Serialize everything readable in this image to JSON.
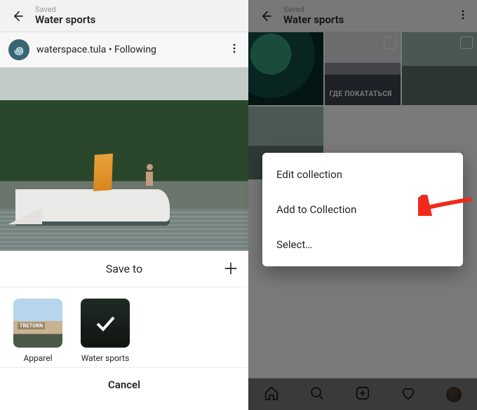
{
  "left": {
    "header": {
      "saved_label": "Saved",
      "collection_name": "Water sports"
    },
    "user": {
      "username": "waterspace.tula",
      "follow_status": "Following",
      "avatar_initial": "꩜"
    },
    "sheet": {
      "title": "Save to",
      "collections": [
        {
          "label": "Apparel",
          "brand_tag": "TRETORN"
        },
        {
          "label": "Water sports"
        }
      ],
      "cancel_label": "Cancel"
    }
  },
  "right": {
    "header": {
      "saved_label": "Saved",
      "collection_name": "Water sports"
    },
    "grid": {
      "tile2_caption": "ГДЕ ПОКАТАТЬСЯ",
      "tile2_sub": ""
    },
    "menu": {
      "items": [
        {
          "label": "Edit collection"
        },
        {
          "label": "Add to Collection"
        },
        {
          "label": "Select…"
        }
      ]
    }
  }
}
